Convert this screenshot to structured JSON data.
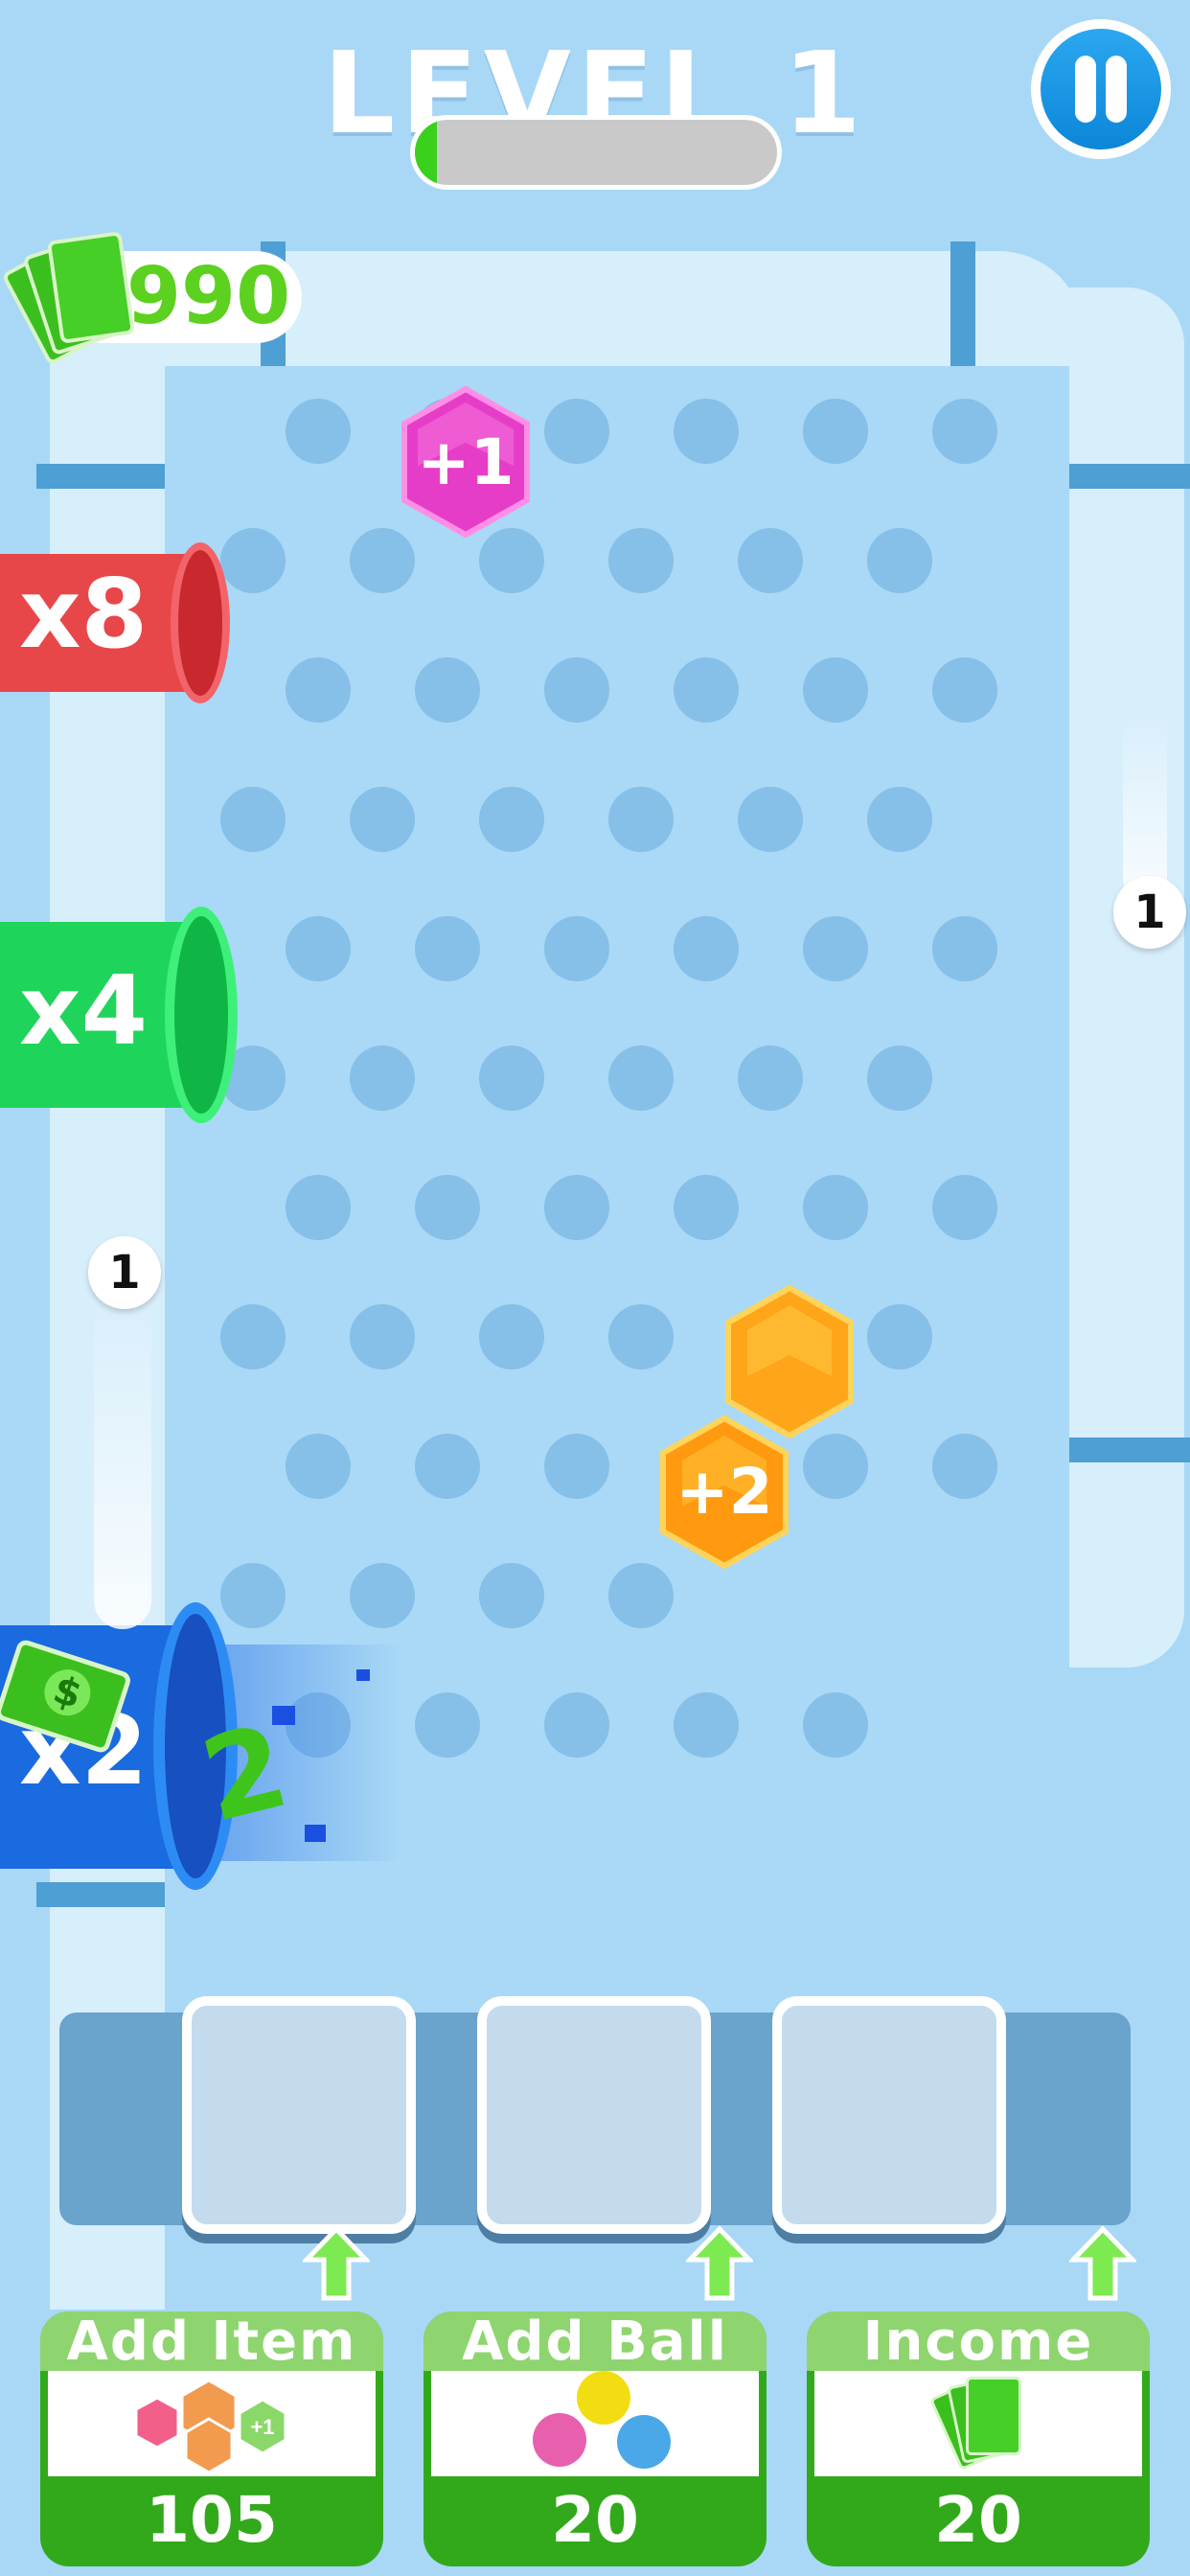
{
  "header": {
    "level_title": "LEVEL 1",
    "progress": 0.06
  },
  "wallet": {
    "amount": "990",
    "icon": "cash-stack-icon"
  },
  "multipliers": [
    {
      "label": "x8",
      "color": "#e8474a"
    },
    {
      "label": "x4",
      "color": "#1fd45a"
    },
    {
      "label": "x2",
      "color": "#1a6ae0"
    }
  ],
  "board": {
    "items": [
      {
        "type": "hex",
        "label": "+1",
        "color": "#e63dc8"
      },
      {
        "type": "hex",
        "label": "",
        "color": "#ffa51a"
      },
      {
        "type": "hex",
        "label": "+2",
        "color": "#ff9a10"
      }
    ],
    "balls": [
      {
        "label": "1"
      },
      {
        "label": "1"
      }
    ],
    "score_popup": "2"
  },
  "slots": {
    "count": 3
  },
  "shop": [
    {
      "title": "Add Item",
      "price": "105",
      "icon": "hexagon-items-icon"
    },
    {
      "title": "Add Ball",
      "price": "20",
      "icon": "colored-balls-icon"
    },
    {
      "title": "Income",
      "price": "20",
      "icon": "cash-stack-icon"
    }
  ],
  "colors": {
    "accent": "#39d11d",
    "board": "#a9d9f6",
    "peg": "#86bfe8",
    "pause": "#0c86d8"
  }
}
